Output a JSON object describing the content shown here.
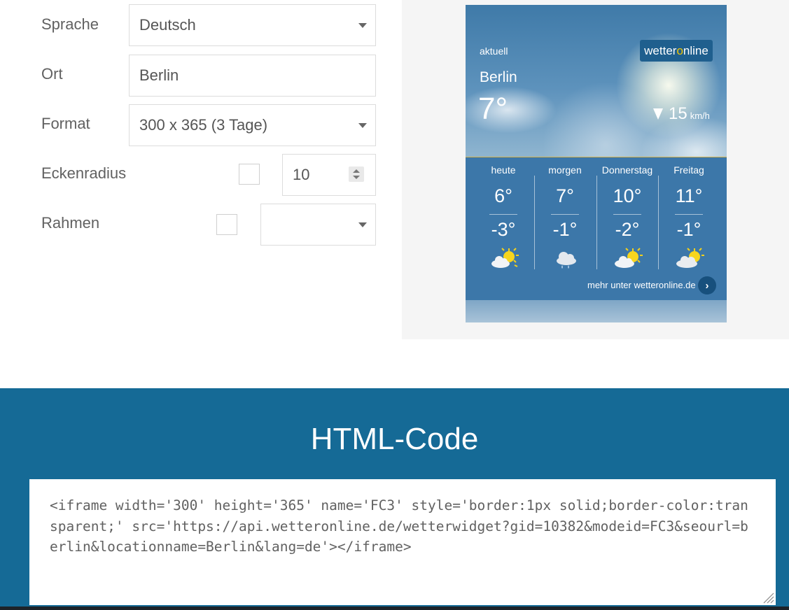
{
  "form": {
    "language": {
      "label": "Sprache",
      "value": "Deutsch"
    },
    "location": {
      "label": "Ort",
      "value": "Berlin"
    },
    "format": {
      "label": "Format",
      "value": "300 x 365 (3 Tage)"
    },
    "corner_radius": {
      "label": "Eckenradius",
      "value": "10",
      "checked": false
    },
    "border": {
      "label": "Rahmen",
      "value": "",
      "checked": false
    }
  },
  "widget": {
    "current_label": "aktuell",
    "city": "Berlin",
    "temperature": "7°",
    "wind_speed": "15",
    "wind_unit": "km/h",
    "logo_text_a": "wetter",
    "logo_text_o": "o",
    "logo_text_b": "nline",
    "forecast": [
      {
        "day": "heute",
        "max": "6°",
        "min": "-3°",
        "icon": "sun-cloud-icon"
      },
      {
        "day": "morgen",
        "max": "7°",
        "min": "-1°",
        "icon": "rain-cloud-icon"
      },
      {
        "day": "Donnerstag",
        "max": "10°",
        "min": "-2°",
        "icon": "sun-cloud-icon"
      },
      {
        "day": "Freitag",
        "max": "11°",
        "min": "-1°",
        "icon": "sun-cloud-icon"
      }
    ],
    "more_link": "mehr unter wetteronline.de",
    "more_arrow": "›"
  },
  "code_section": {
    "title": "HTML-Code",
    "code": "<iframe width='300' height='365' name='FC3' style='border:1px solid;border-color:transparent;' src='https://api.wetteronline.de/wetterwidget?gid=10382&modeid=FC3&seourl=berlin&locationname=Berlin&lang=de'></iframe>"
  },
  "colors": {
    "section_blue": "#156a96",
    "widget_blue": "#3c77a9",
    "logo_accent": "#f2c500"
  }
}
